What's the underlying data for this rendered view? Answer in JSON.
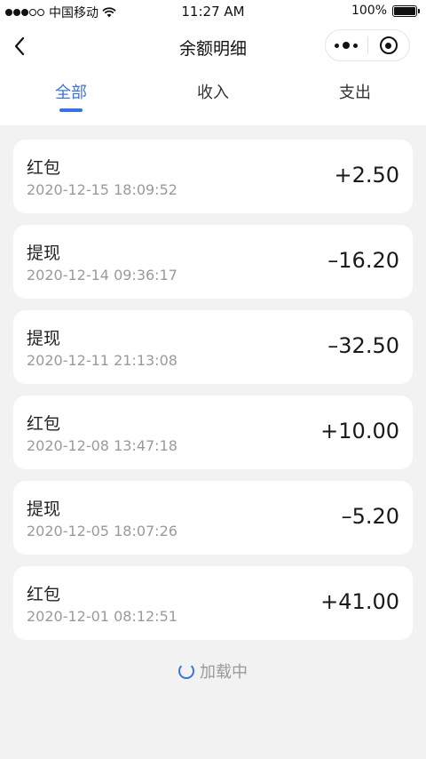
{
  "status_bar": {
    "carrier": "中国移动",
    "time": "11:27 AM",
    "battery_percent": "100%",
    "signal_filled": 3,
    "signal_empty": 2
  },
  "nav": {
    "title": "余额明细",
    "back_icon": "chevron-left-icon",
    "more_icon": "more-dots-icon",
    "close_icon": "target-icon"
  },
  "tabs": [
    {
      "label": "全部",
      "active": true
    },
    {
      "label": "收入",
      "active": false
    },
    {
      "label": "支出",
      "active": false
    }
  ],
  "transactions": [
    {
      "type": "红包",
      "time": "2020-12-15 18:09:52",
      "amount": "+2.50"
    },
    {
      "type": "提现",
      "time": "2020-12-14 09:36:17",
      "amount": "–16.20"
    },
    {
      "type": "提现",
      "time": "2020-12-11 21:13:08",
      "amount": "–32.50"
    },
    {
      "type": "红包",
      "time": "2020-12-08 13:47:18",
      "amount": "+10.00"
    },
    {
      "type": "提现",
      "time": "2020-12-05 18:07:26",
      "amount": "–5.20"
    },
    {
      "type": "红包",
      "time": "2020-12-01 08:12:51",
      "amount": "+41.00"
    }
  ],
  "loading_text": "加载中",
  "colors": {
    "accent": "#3a73e0",
    "background": "#f2f2f2",
    "muted": "#9a9a9a"
  }
}
